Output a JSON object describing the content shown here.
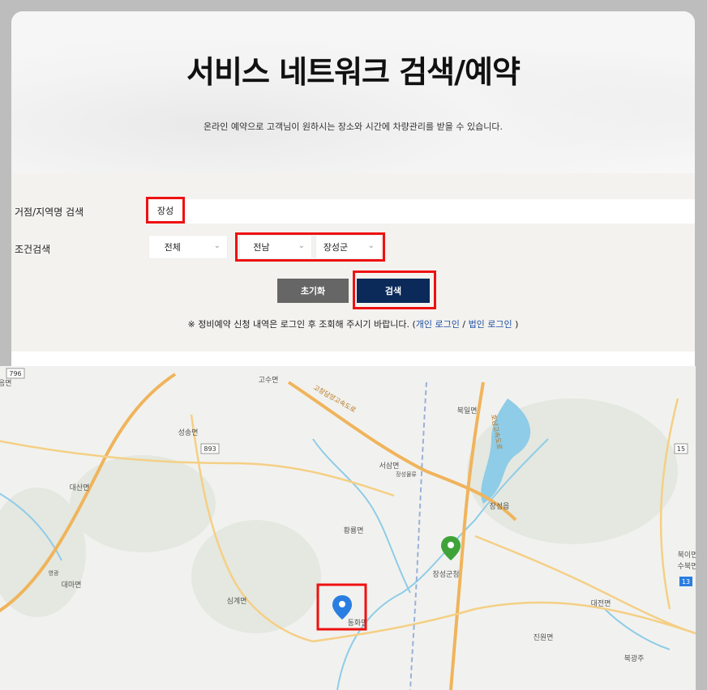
{
  "header": {
    "title": "서비스 네트워크 검색/예약",
    "subtitle": "온라인 예약으로 고객님이 원하시는 장소와 시간에 차량관리를 받을 수 있습니다."
  },
  "search": {
    "label": "거점/지역명 검색",
    "keyword": "장성",
    "placeholder": ""
  },
  "conditions": {
    "label": "조건검색",
    "type_value": "전체",
    "province_value": "전남",
    "city_value": "장성군"
  },
  "buttons": {
    "reset_label": "초기화",
    "search_label": "검색"
  },
  "notice": {
    "prefix": "※ 정비예약 신청 내역은 로그인 후 조회해 주시기 바랍니다. (",
    "personal_login": "개인 로그인",
    "separator": " / ",
    "corporate_login": "법인 로그인",
    "suffix": " )"
  },
  "map": {
    "places": [
      "고수면",
      "성송면",
      "대산면",
      "대마면",
      "심계면",
      "황룡면",
      "서삼면",
      "북일면",
      "장성읍",
      "장성군청",
      "동화면",
      "진원면",
      "대전면",
      "북이면",
      "수북면",
      "공음면",
      "북광주",
      "장성물류",
      "고창담양고속도로",
      "호남고속도로",
      "영광"
    ],
    "road_shields": [
      "796",
      "893",
      "15",
      "13"
    ],
    "colors": {
      "land": "#f1f2ef",
      "road": "#f0b45c",
      "water": "#8fcce8",
      "green_pin": "#3fa33a",
      "blue_pin": "#2a7de1"
    }
  }
}
